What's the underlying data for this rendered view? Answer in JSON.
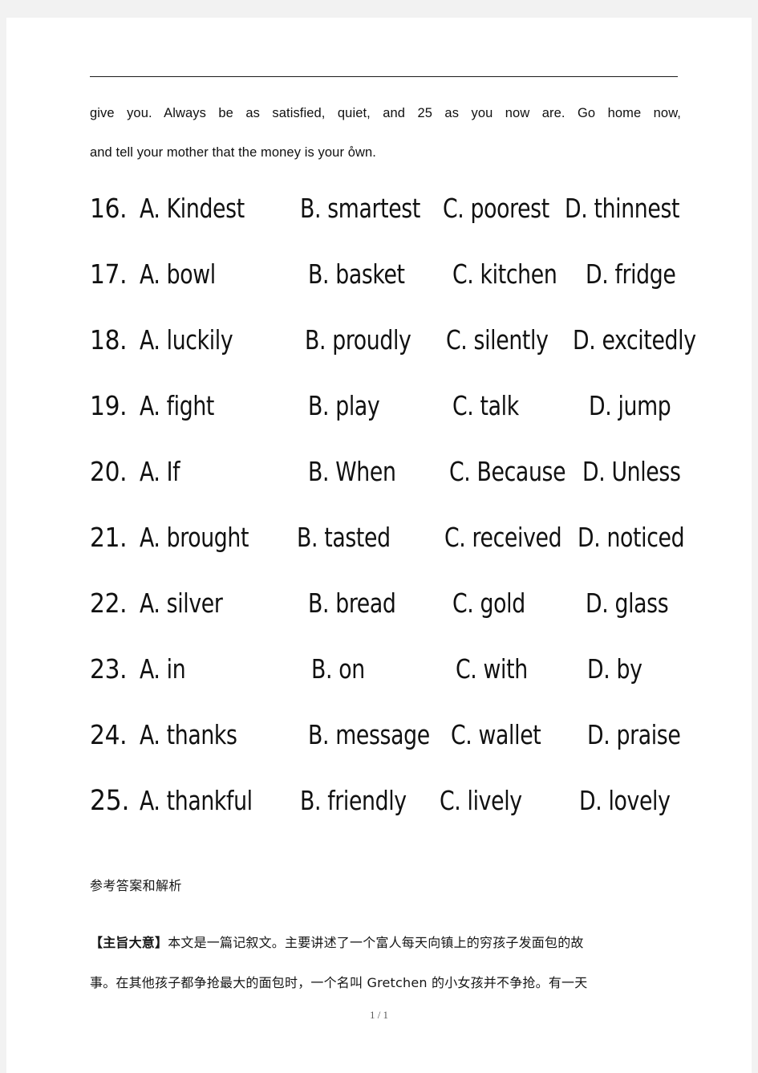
{
  "page": {
    "footer_label": "1 / 1"
  },
  "passage": {
    "line1": "give you. Always be as satisfied, quiet, and 25 as you now are. Go home now,",
    "line2": "and tell your mother that the money is your o̊wn."
  },
  "questions": [
    {
      "number": "16.",
      "a": "A. Kindest",
      "b": "B. smartest",
      "c": "C. poorest",
      "d": "D. thinnest"
    },
    {
      "number": "17.",
      "a": "A. bowl",
      "b": "B. basket",
      "c": "C. kitchen",
      "d": "D. fridge"
    },
    {
      "number": "18.",
      "a": "A. luckily",
      "b": "B. proudly",
      "c": "C. silently",
      "d": "D. excitedly"
    },
    {
      "number": "19.",
      "a": "A. fight",
      "b": "B. play",
      "c": "C. talk",
      "d": "D. jump"
    },
    {
      "number": "20.",
      "a": "A. If",
      "b": "B. When",
      "c": "C. Because",
      "d": "D. Unless"
    },
    {
      "number": "21.",
      "a": "A. brought",
      "b": "B. tasted",
      "c": "C. received",
      "d": "D. noticed"
    },
    {
      "number": "22.",
      "a": "A. silver",
      "b": "B. bread",
      "c": "C. gold",
      "d": "D. glass"
    },
    {
      "number": "23.",
      "a": "A. in",
      "b": "B. on",
      "c": "C. with",
      "d": "D. by"
    },
    {
      "number": "24.",
      "a": "A. thanks",
      "b": "B. message",
      "c": "C. wallet",
      "d": "D. praise"
    },
    {
      "number": "25.",
      "a": "A. thankful",
      "b": "B. friendly",
      "c": "C. lively",
      "d": "D. lovely"
    }
  ],
  "analysis": {
    "heading": "参考答案和解析",
    "label": "【主旨大意】",
    "line1_rest": "本文是一篇记叙文。主要讲述了一个富人每天向镇上的穷孩子发面包的故",
    "line2": "事。在其他孩子都争抢最大的面包时，一个名叫 Gretchen 的小女孩并不争抢。有一天"
  }
}
